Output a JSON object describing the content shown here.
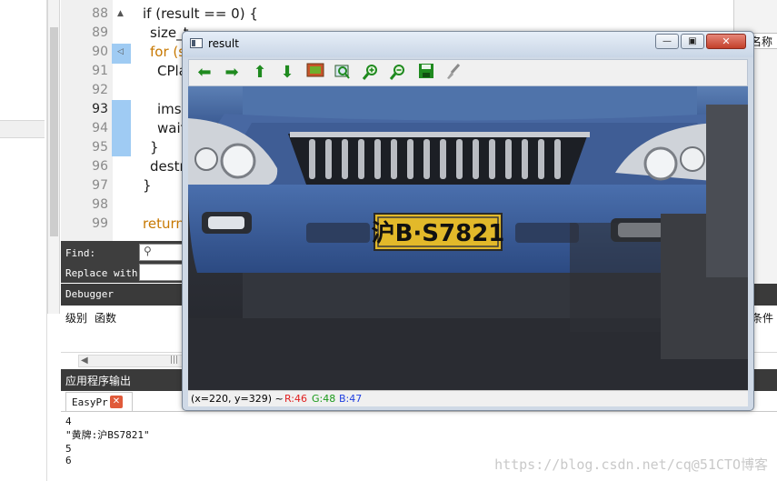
{
  "editor": {
    "lines": [
      {
        "no": "88",
        "code": "if (result == 0) {"
      },
      {
        "no": "89",
        "code": "size_t ..."
      },
      {
        "no": "90",
        "code": "for (s"
      },
      {
        "no": "91",
        "code": "CPla"
      },
      {
        "no": "92",
        "code": ""
      },
      {
        "no": "93",
        "code": "imsh"
      },
      {
        "no": "94",
        "code": "wait"
      },
      {
        "no": "95",
        "code": "}"
      },
      {
        "no": "96",
        "code": "destr"
      },
      {
        "no": "97",
        "code": "}"
      },
      {
        "no": "98",
        "code": ""
      },
      {
        "no": "99",
        "code": "return"
      }
    ],
    "right_tab": "名称"
  },
  "find": {
    "find_label": "Find:",
    "replace_label": "Replace with:"
  },
  "debugger": {
    "title": "Debugger",
    "columns": [
      "级别",
      "函数"
    ],
    "right_column": "条件"
  },
  "output": {
    "header": "应用程序输出",
    "tab_label": "EasyPr",
    "lines": [
      "4",
      "\"黄牌:沪BS7821\"",
      "5",
      "6"
    ]
  },
  "result_window": {
    "title": "result",
    "toolbar_icons": [
      "arrow-left-icon",
      "arrow-right-icon",
      "arrow-up-icon",
      "arrow-down-icon",
      "image-icon",
      "zoom-fit-icon",
      "zoom-in-icon",
      "zoom-out-icon",
      "save-icon",
      "brush-icon"
    ],
    "plate_text": "沪B·S7821",
    "status": {
      "coords": "(x=220, y=329) ~",
      "r": "R:46",
      "g": "G:48",
      "b": "B:47"
    },
    "colors": {
      "r": "#e02020",
      "g": "#1a9a1a",
      "b": "#2040e0"
    }
  },
  "watermark": "https://blog.csdn.net/cq@51CTO博客"
}
